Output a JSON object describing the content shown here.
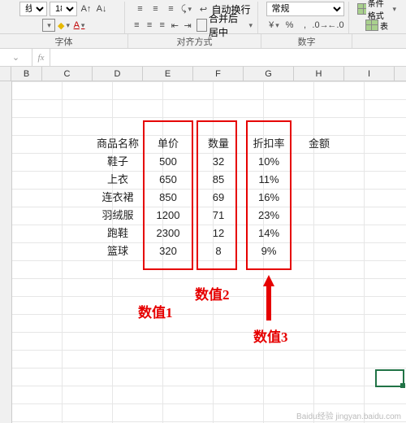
{
  "ribbon": {
    "line_style": "线",
    "font_size": "18",
    "wrap_label": "自动换行",
    "merge_label": "合并后居中",
    "num_format": "常规",
    "cond_fmt": "条件格式",
    "table_btn": "表",
    "groups": {
      "font": "字体",
      "align": "对齐方式",
      "number": "数字"
    }
  },
  "formula_bar": {
    "fx_glyph": "fx",
    "chevron": "⌄",
    "value": ""
  },
  "columns": [
    "B",
    "C",
    "D",
    "E",
    "F",
    "G",
    "H",
    "I"
  ],
  "table": {
    "headers": {
      "name": "商品名称",
      "price": "单价",
      "qty": "数量",
      "discount": "折扣率",
      "amount": "金额"
    },
    "rows": [
      {
        "name": "鞋子",
        "price": "500",
        "qty": "32",
        "discount": "10%"
      },
      {
        "name": "上衣",
        "price": "650",
        "qty": "85",
        "discount": "11%"
      },
      {
        "name": "连衣裙",
        "price": "850",
        "qty": "69",
        "discount": "16%"
      },
      {
        "name": "羽绒服",
        "price": "1200",
        "qty": "71",
        "discount": "23%"
      },
      {
        "name": "跑鞋",
        "price": "2300",
        "qty": "12",
        "discount": "14%"
      },
      {
        "name": "篮球",
        "price": "320",
        "qty": "8",
        "discount": "9%"
      }
    ]
  },
  "annotations": {
    "v1": "数值1",
    "v2": "数值2",
    "v3": "数值3"
  },
  "watermark": "Baidu经验  jingyan.baidu.com",
  "chart_data": {
    "type": "table",
    "columns": [
      "商品名称",
      "单价",
      "数量",
      "折扣率",
      "金额"
    ],
    "rows": [
      [
        "鞋子",
        500,
        32,
        0.1,
        null
      ],
      [
        "上衣",
        650,
        85,
        0.11,
        null
      ],
      [
        "连衣裙",
        850,
        69,
        0.16,
        null
      ],
      [
        "羽绒服",
        1200,
        71,
        0.23,
        null
      ],
      [
        "跑鞋",
        2300,
        12,
        0.14,
        null
      ],
      [
        "篮球",
        320,
        8,
        0.09,
        null
      ]
    ]
  }
}
